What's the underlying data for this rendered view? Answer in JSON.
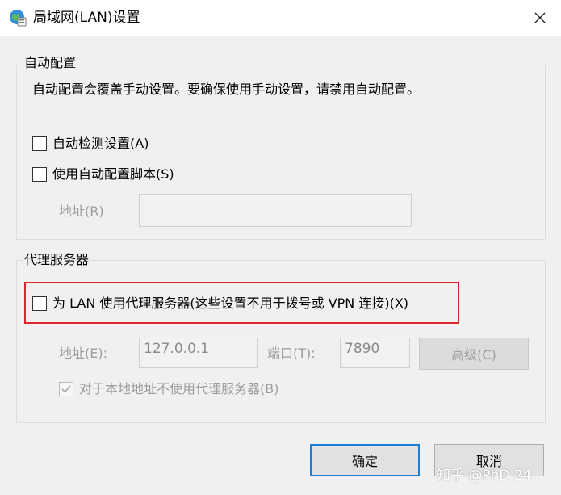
{
  "window": {
    "title": "局域网(LAN)设置",
    "icon": "globe-settings-icon",
    "close_label": "✕"
  },
  "auto_config": {
    "group_label": "自动配置",
    "description": "自动配置会覆盖手动设置。要确保使用手动设置，请禁用自动配置。",
    "auto_detect_label": "自动检测设置(A)",
    "auto_detect_checked": false,
    "use_script_label": "使用自动配置脚本(S)",
    "use_script_checked": false,
    "address_label": "地址(R)",
    "address_value": ""
  },
  "proxy": {
    "group_label": "代理服务器",
    "use_proxy_label": "为 LAN 使用代理服务器(这些设置不用于拨号或 VPN 连接)(X)",
    "use_proxy_checked": false,
    "address_label": "地址(E):",
    "address_value": "127.0.0.1",
    "port_label": "端口(T):",
    "port_value": "7890",
    "advanced_label": "高级(C)",
    "bypass_local_label": "对于本地地址不使用代理服务器(B)",
    "bypass_local_checked": true
  },
  "buttons": {
    "ok": "确定",
    "cancel": "取消"
  },
  "watermark": "知乎 @PhD 24",
  "colors": {
    "highlight": "#e0242b",
    "ok_border": "#1c7fd6",
    "disabled_text": "#9d9d9d"
  }
}
